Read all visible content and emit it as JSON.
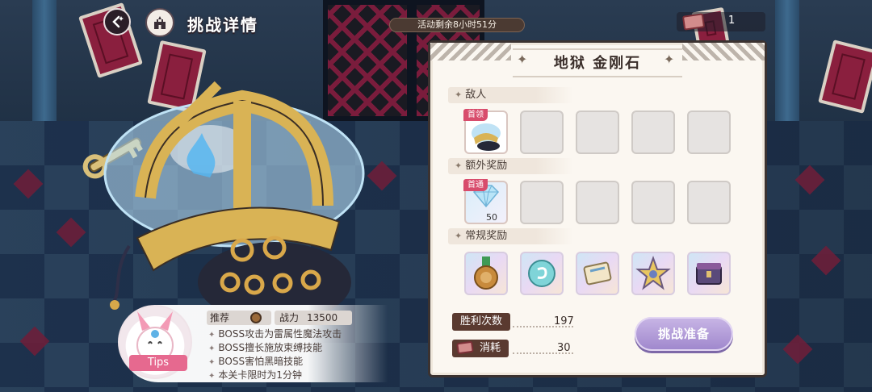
{
  "header": {
    "title": "挑战详情",
    "timer": "活动剩余8小时51分",
    "ticket_count": "1"
  },
  "icons": {
    "back": "back-arrow-icon",
    "home": "castle-home-icon",
    "ticket": "ticket-icon"
  },
  "panel": {
    "title": "地狱 金刚石",
    "sections": {
      "enemy": "敌人",
      "extra_reward": "额外奖励",
      "regular_reward": "常规奖励"
    },
    "enemy_tag": "首领",
    "extra_tag": "首通",
    "extra_qty": "50",
    "stats": {
      "wins_label": "胜利次数",
      "wins_value": "197",
      "cost_label": "消耗",
      "cost_value": "30"
    },
    "ready_button": "挑战准备"
  },
  "tips": {
    "label": "Tips",
    "recommend_label": "推荐",
    "power_label": "战力",
    "power_value": "13500",
    "lines": [
      "BOSS攻击为雷属性魔法攻击",
      "BOSS擅长施放束缚技能",
      "BOSS害怕黑暗技能",
      "本关卡限时为1分钟"
    ]
  },
  "colors": {
    "accent_ready": "#9e86cc",
    "tag_red": "#d84c6c",
    "stat_label_bg": "#5a3a30"
  }
}
